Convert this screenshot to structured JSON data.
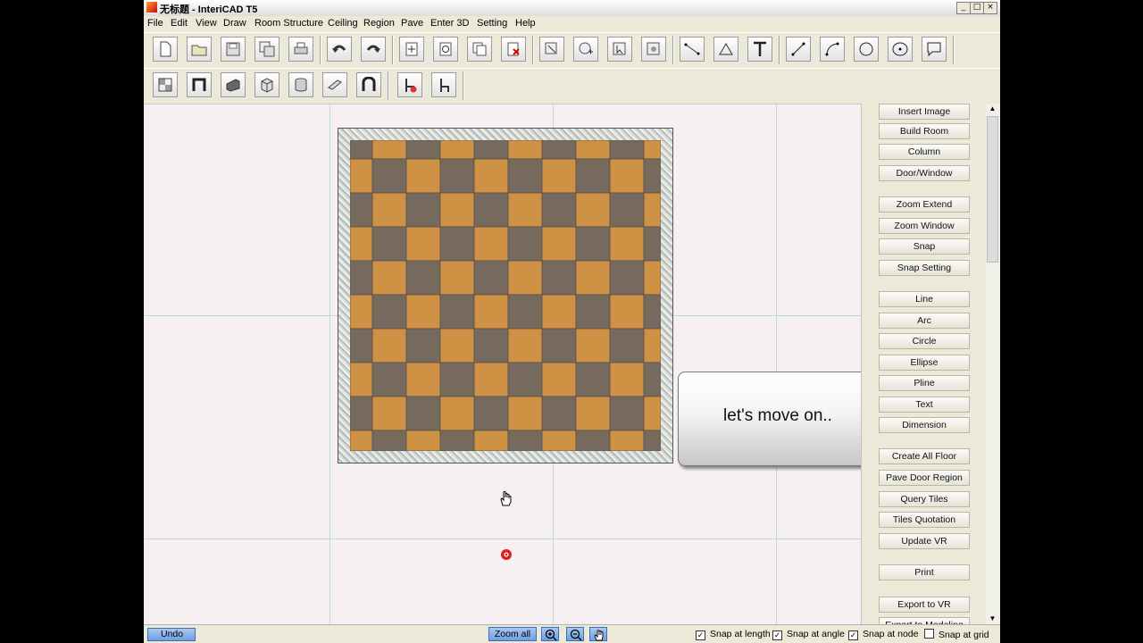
{
  "window": {
    "title": "无标题 - InteriCAD T5",
    "controls": {
      "minimize": "_",
      "maximize": "□",
      "close": "×"
    }
  },
  "menu": {
    "items": [
      "File",
      "Edit",
      "View",
      "Draw",
      "Room Structure",
      "Ceiling",
      "Region",
      "Pave",
      "Enter 3D",
      "Setting",
      "Help"
    ]
  },
  "toolbar1": {
    "icons": [
      "new-file-icon",
      "open-folder-icon",
      "save-icon",
      "save-as-icon",
      "print-icon",
      "undo-icon",
      "redo-icon",
      "move-icon",
      "rotate-icon",
      "copy-icon",
      "delete-icon",
      "rect-zoom-icon",
      "add-zoom-icon",
      "pan-select-icon",
      "orbit-icon",
      "measure-line-icon",
      "angle-icon",
      "text-icon",
      "line-icon",
      "arc-icon",
      "circle-icon",
      "ellipse-icon",
      "callout-icon"
    ]
  },
  "toolbar2": {
    "icons": [
      "floor-pattern-icon",
      "door-frame-icon",
      "wall-block-icon",
      "box-icon",
      "cylinder-icon",
      "beam-icon",
      "arch-door-icon",
      "furniture-chair-icon",
      "chair-icon"
    ]
  },
  "canvas": {
    "tile_colors": {
      "orange": "#cf9244",
      "brown": "#766a5e",
      "border": "#cfd4cf"
    },
    "callout_text": "let's move on.."
  },
  "sidepanel": {
    "buttons": [
      "Insert Image",
      "Build Room",
      "Column",
      "Door/Window",
      "Zoom Extend",
      "Zoom Window",
      "Snap",
      "Snap Setting",
      "Line",
      "Arc",
      "Circle",
      "Ellipse",
      "Pline",
      "Text",
      "Dimension",
      "Create All Floor",
      "Pave Door Region",
      "Query Tiles",
      "Tiles Quotation",
      "Update VR",
      "Print",
      "Export to VR",
      "Export to Modeling"
    ]
  },
  "statusbar": {
    "undo_label": "Undo",
    "zoom_all_label": "Zoom all",
    "snaps": [
      {
        "label": "Snap at length",
        "checked": true
      },
      {
        "label": "Snap at angle",
        "checked": true
      },
      {
        "label": "Snap at node",
        "checked": true
      },
      {
        "label": "Snap at grid",
        "checked": false
      }
    ]
  }
}
